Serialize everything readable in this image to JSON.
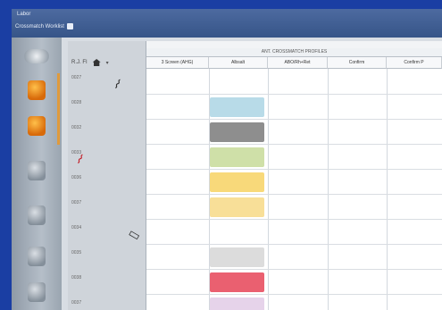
{
  "titlebar": {
    "menu_label": "Labor",
    "sub_label": "Crossmatch Worklist"
  },
  "panel": {
    "group_header": "ANT. CROSSMATCH PROFILES",
    "columns": [
      "3 Screen (AHG)",
      "Albsalt",
      "ABO/Rh+Ret",
      "Confirm",
      "Confirm P"
    ],
    "toolbar": {
      "left_label": "R.J. FI",
      "home_icon": "home-icon",
      "menu_icon": "chevron-down-icon"
    },
    "rows": [
      {
        "label": "0027",
        "icon": "paperclip-icon"
      },
      {
        "label": "0028",
        "icon": ""
      },
      {
        "label": "0032",
        "icon": ""
      },
      {
        "label": "0033",
        "icon": "red-paperclip-icon"
      },
      {
        "label": "0036",
        "icon": ""
      },
      {
        "label": "0037",
        "icon": ""
      },
      {
        "label": "0034",
        "icon": "phone-icon"
      },
      {
        "label": "0035",
        "icon": ""
      },
      {
        "label": "0038",
        "icon": ""
      },
      {
        "label": "0037",
        "icon": ""
      }
    ],
    "swatches": [
      {
        "row": 1,
        "color": "#b8dbe8"
      },
      {
        "row": 2,
        "color": "#8e8e8e"
      },
      {
        "row": 3,
        "color": "#cfe0a8"
      },
      {
        "row": 4,
        "color": "#f8d97a"
      },
      {
        "row": 5,
        "color": "#f8df98"
      },
      {
        "row": 7,
        "color": "#dcdcdc"
      },
      {
        "row": 8,
        "color": "#ea6070"
      },
      {
        "row": 9,
        "color": "#e6d3ea"
      }
    ]
  },
  "colors": {
    "background": "#1a3ea3",
    "accent": "#e09a3c"
  }
}
